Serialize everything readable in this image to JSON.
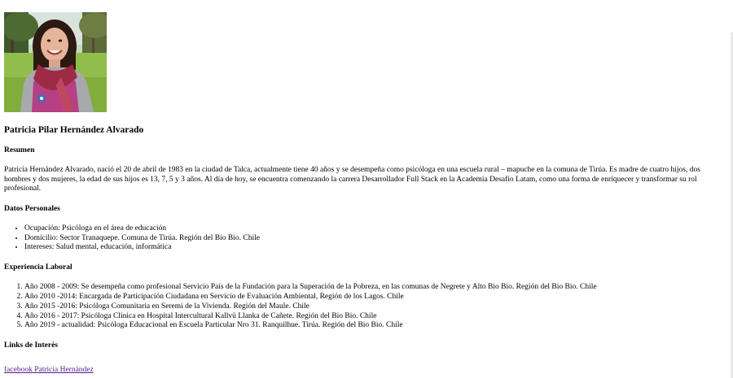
{
  "profile": {
    "name": "Patricia Pilar Hernández Alvarado"
  },
  "resumen": {
    "heading": "Resumen",
    "text": "Patricia Hernández Alvarado, nació el 20 de abril de 1983 en la ciudad de Talca, actualmente tiene 40 años y se desempeña como psicóloga en una escuela rural – mapuche en la comuna de Tirúa. Es madre de cuatro hijos, dos hombres y dos mujeres, la edad de sus hijos es 13, 7, 5 y 3 años. Al día de hoy, se encuentra comenzando la carrera Desarrollador Full Stack en la Academia Desafío Latam, como una forma de enriquecer y transformar su rol profesional."
  },
  "datos": {
    "heading": "Datos Personales",
    "items": [
      "Ocupación: Psicóloga en el área de educación",
      "Domicilio: Sector Tranaquepe. Comuna de Tirúa. Región del Bio Bio. Chile",
      "Intereses: Salud mental, educación, informática"
    ]
  },
  "experiencia": {
    "heading": "Experiencia Laboral",
    "items": [
      "Año 2008 - 2009: Se desempeña como profesional Servicio País de la Fundación para la Superación de la Pobreza, en las comunas de Negrete y Alto Bio Bio. Región del Bio Bio. Chile",
      "Año 2010 -2014: Encargada de Participación Ciudadana en Servicio de Evaluación Ambiental, Región de los Lagos. Chile",
      "Año 2015 -2016: Psicóloga Comunitaria en Seremi de la Vivienda. Región del Maule. Chile",
      "Año 2016 - 2017: Psicóloga Clínica en Hospital Intercultural Kallvü Llanka de Cañete. Región del Bio Bio. Chile",
      "Año 2019 - actualidad: Psicóloga Educacional en Escuela Particular Nro 31. Ranquilhue. Tirúa. Región del Bio Bio. Chile"
    ]
  },
  "links": {
    "heading": "Links de Interés",
    "facebook_label": "facebook Patricia Hernández"
  },
  "colors": {
    "link_visited": "#551a8b",
    "text": "#000000",
    "background": "#ffffff"
  }
}
